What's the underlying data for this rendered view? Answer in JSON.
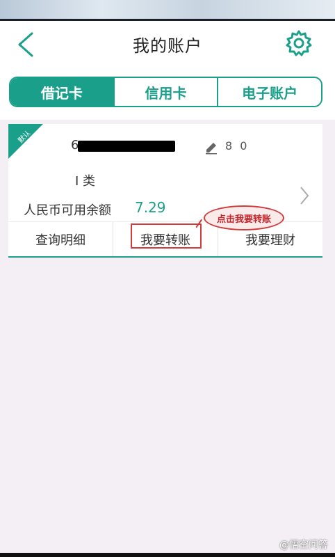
{
  "header": {
    "title": "我的账户"
  },
  "tabs": [
    {
      "label": "借记卡",
      "active": true
    },
    {
      "label": "信用卡",
      "active": false
    },
    {
      "label": "电子账户",
      "active": false
    }
  ],
  "card": {
    "badge": "默认",
    "card_number": "6",
    "alias": "8     0",
    "card_type": "I 类",
    "balance_label": "人民币可用余额",
    "balance_value": "7.29",
    "actions": [
      {
        "label": "查询明细"
      },
      {
        "label": "我要转账"
      },
      {
        "label": "我要理财"
      }
    ]
  },
  "annotation": {
    "callout_text": "点击我要转账"
  },
  "watermark": {
    "text": "@悟空问答"
  },
  "colors": {
    "accent": "#1aa08a",
    "annotation": "#d13b3b"
  },
  "icons": [
    "back-icon",
    "gear-icon",
    "edit-icon",
    "chevron-right-icon"
  ]
}
